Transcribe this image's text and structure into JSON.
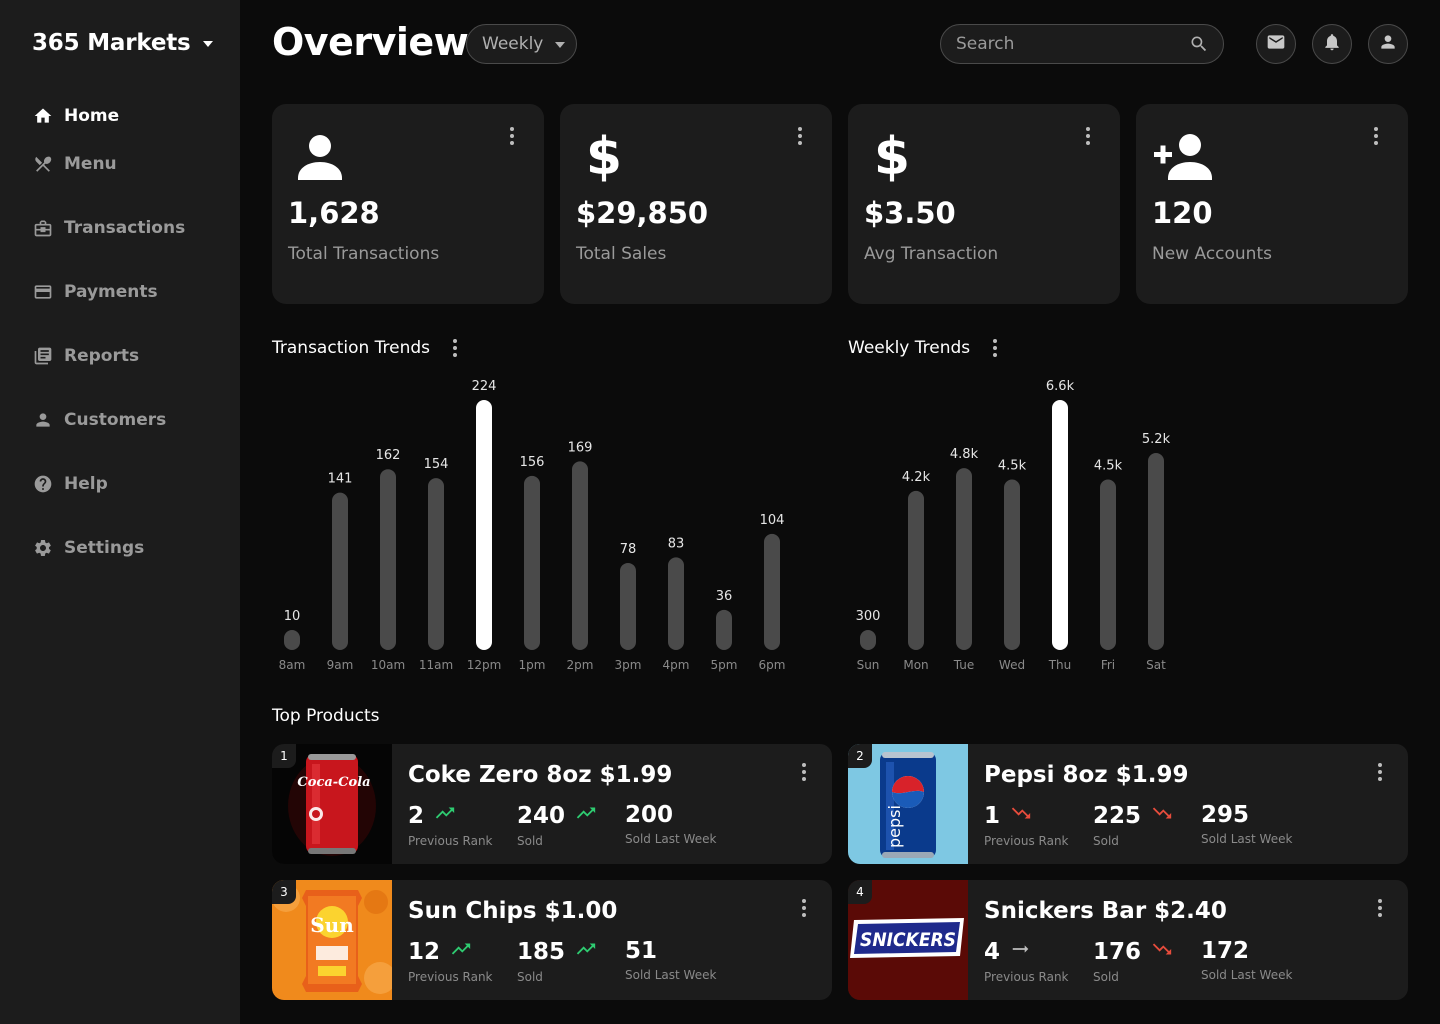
{
  "sidebar": {
    "brand": "365 Markets",
    "items": [
      {
        "label": "Home",
        "icon": "home-icon",
        "active": true
      },
      {
        "label": "Menu",
        "icon": "utensils-icon"
      },
      {
        "label": "Transactions",
        "icon": "briefcase-icon"
      },
      {
        "label": "Payments",
        "icon": "credit-card-icon"
      },
      {
        "label": "Reports",
        "icon": "reports-icon"
      },
      {
        "label": "Customers",
        "icon": "person-icon"
      },
      {
        "label": "Help",
        "icon": "help-icon"
      },
      {
        "label": "Settings",
        "icon": "gear-icon"
      }
    ]
  },
  "header": {
    "title": "Overview",
    "period": "Weekly",
    "search_placeholder": "Search"
  },
  "stats": [
    {
      "icon": "person-icon",
      "value": "1,628",
      "label": "Total Transactions"
    },
    {
      "icon": "dollar-icon",
      "value": "$29,850",
      "label": "Total Sales"
    },
    {
      "icon": "dollar-icon",
      "value": "$3.50",
      "label": "Avg Transaction"
    },
    {
      "icon": "add-person-icon",
      "value": "120",
      "label": "New Accounts"
    }
  ],
  "sections": {
    "transaction_trends": "Transaction Trends",
    "weekly_trends": "Weekly Trends",
    "top_products": "Top Products"
  },
  "chart_data": [
    {
      "type": "bar",
      "title": "Transaction Trends",
      "categories": [
        "8am",
        "9am",
        "10am",
        "11am",
        "12pm",
        "1pm",
        "2pm",
        "3pm",
        "4pm",
        "5pm",
        "6pm"
      ],
      "values": [
        10,
        141,
        162,
        154,
        224,
        156,
        169,
        78,
        83,
        36,
        104
      ],
      "labels": [
        "10",
        "141",
        "162",
        "154",
        "224",
        "156",
        "169",
        "78",
        "83",
        "36",
        "104"
      ],
      "highlight": "12pm",
      "colors": {
        "bar": "#4a4a4a",
        "highlight": "#ffffff"
      }
    },
    {
      "type": "bar",
      "title": "Weekly Trends",
      "categories": [
        "Sun",
        "Mon",
        "Tue",
        "Wed",
        "Thu",
        "Fri",
        "Sat"
      ],
      "values": [
        300,
        4200,
        4800,
        4500,
        6600,
        4500,
        5200
      ],
      "labels": [
        "300",
        "4.2k",
        "4.8k",
        "4.5k",
        "6.6k",
        "4.5k",
        "5.2k"
      ],
      "highlight": "Thu",
      "colors": {
        "bar": "#4a4a4a",
        "highlight": "#ffffff"
      }
    }
  ],
  "products": [
    {
      "rank": "1",
      "name": "Coke Zero 8oz  $1.99",
      "prev_rank": "2",
      "prev_trend": "up",
      "sold": "240",
      "sold_trend": "up",
      "last_week": "200",
      "image": "coke-zero-can-image",
      "image_text": "Coca-Cola"
    },
    {
      "rank": "2",
      "name": "Pepsi 8oz $1.99",
      "prev_rank": "1",
      "prev_trend": "down",
      "sold": "225",
      "sold_trend": "down",
      "last_week": "295",
      "image": "pepsi-can-image",
      "image_text": "pepsi"
    },
    {
      "rank": "3",
      "name": "Sun Chips $1.00",
      "prev_rank": "12",
      "prev_trend": "up",
      "sold": "185",
      "sold_trend": "up",
      "last_week": "51",
      "image": "sun-chips-bag-image",
      "image_text": "Sun"
    },
    {
      "rank": "4",
      "name": "Snickers Bar $2.40",
      "prev_rank": "4",
      "prev_trend": "flat",
      "sold": "176",
      "sold_trend": "down",
      "last_week": "172",
      "image": "snickers-bar-image",
      "image_text": "SNICKERS"
    }
  ],
  "product_labels": {
    "prev_rank": "Previous Rank",
    "sold": "Sold",
    "last_week": "Sold Last Week"
  },
  "colors": {
    "trend_up": "#2ecc71",
    "trend_down": "#e74c3c",
    "card_bg": "#1c1c1c",
    "sidebar_bg": "#1c1c1c",
    "page_bg": "#0b0b0b"
  }
}
